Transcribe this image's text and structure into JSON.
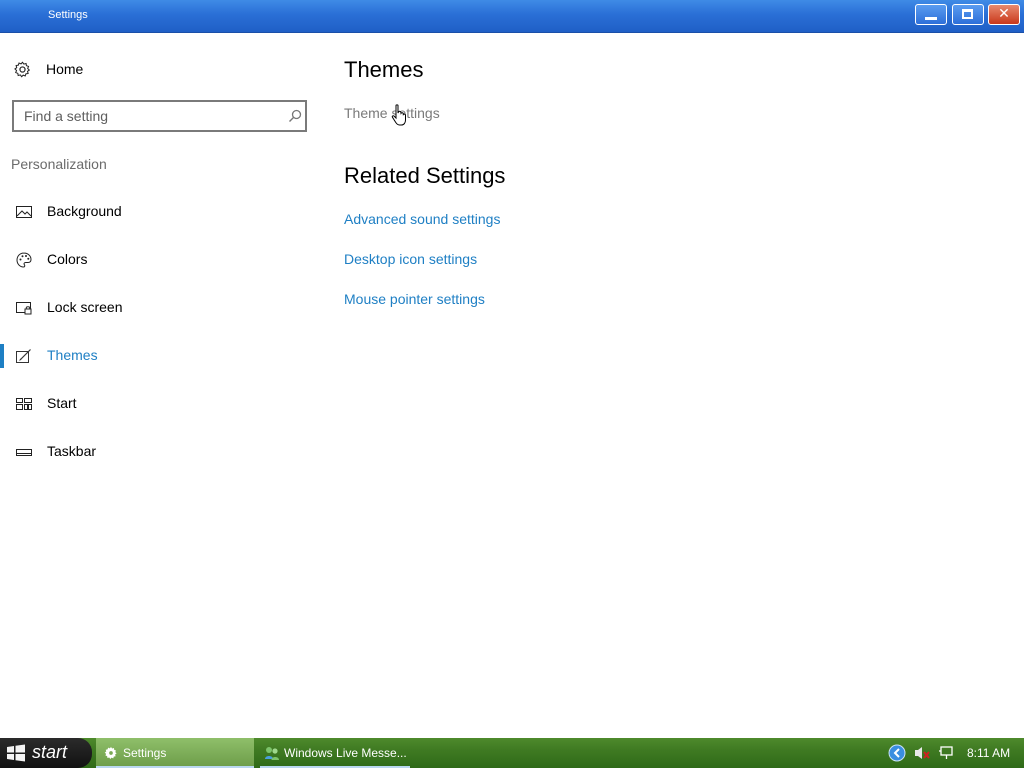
{
  "window": {
    "title": "Settings"
  },
  "sidebar": {
    "home_label": "Home",
    "search_placeholder": "Find a setting",
    "section_label": "Personalization",
    "items": [
      {
        "label": "Background",
        "icon": "picture-icon"
      },
      {
        "label": "Colors",
        "icon": "palette-icon"
      },
      {
        "label": "Lock screen",
        "icon": "lock-screen-icon"
      },
      {
        "label": "Themes",
        "icon": "themes-icon",
        "active": true
      },
      {
        "label": "Start",
        "icon": "start-tiles-icon"
      },
      {
        "label": "Taskbar",
        "icon": "taskbar-icon"
      }
    ]
  },
  "main": {
    "heading": "Themes",
    "theme_settings_link": "Theme settings",
    "related_heading": "Related Settings",
    "related_links": [
      "Advanced sound settings",
      "Desktop icon settings",
      "Mouse pointer settings"
    ]
  },
  "taskbar": {
    "start_label": "start",
    "tasks": [
      {
        "label": "Settings",
        "icon": "gear-icon",
        "active": true
      },
      {
        "label": "Windows Live Messe...",
        "icon": "messenger-icon",
        "active": false
      }
    ],
    "clock": "8:11 AM"
  },
  "colors": {
    "accent": "#1e7fc4",
    "titlebar": "#2a6fd6",
    "taskbar": "#3f7a22"
  }
}
